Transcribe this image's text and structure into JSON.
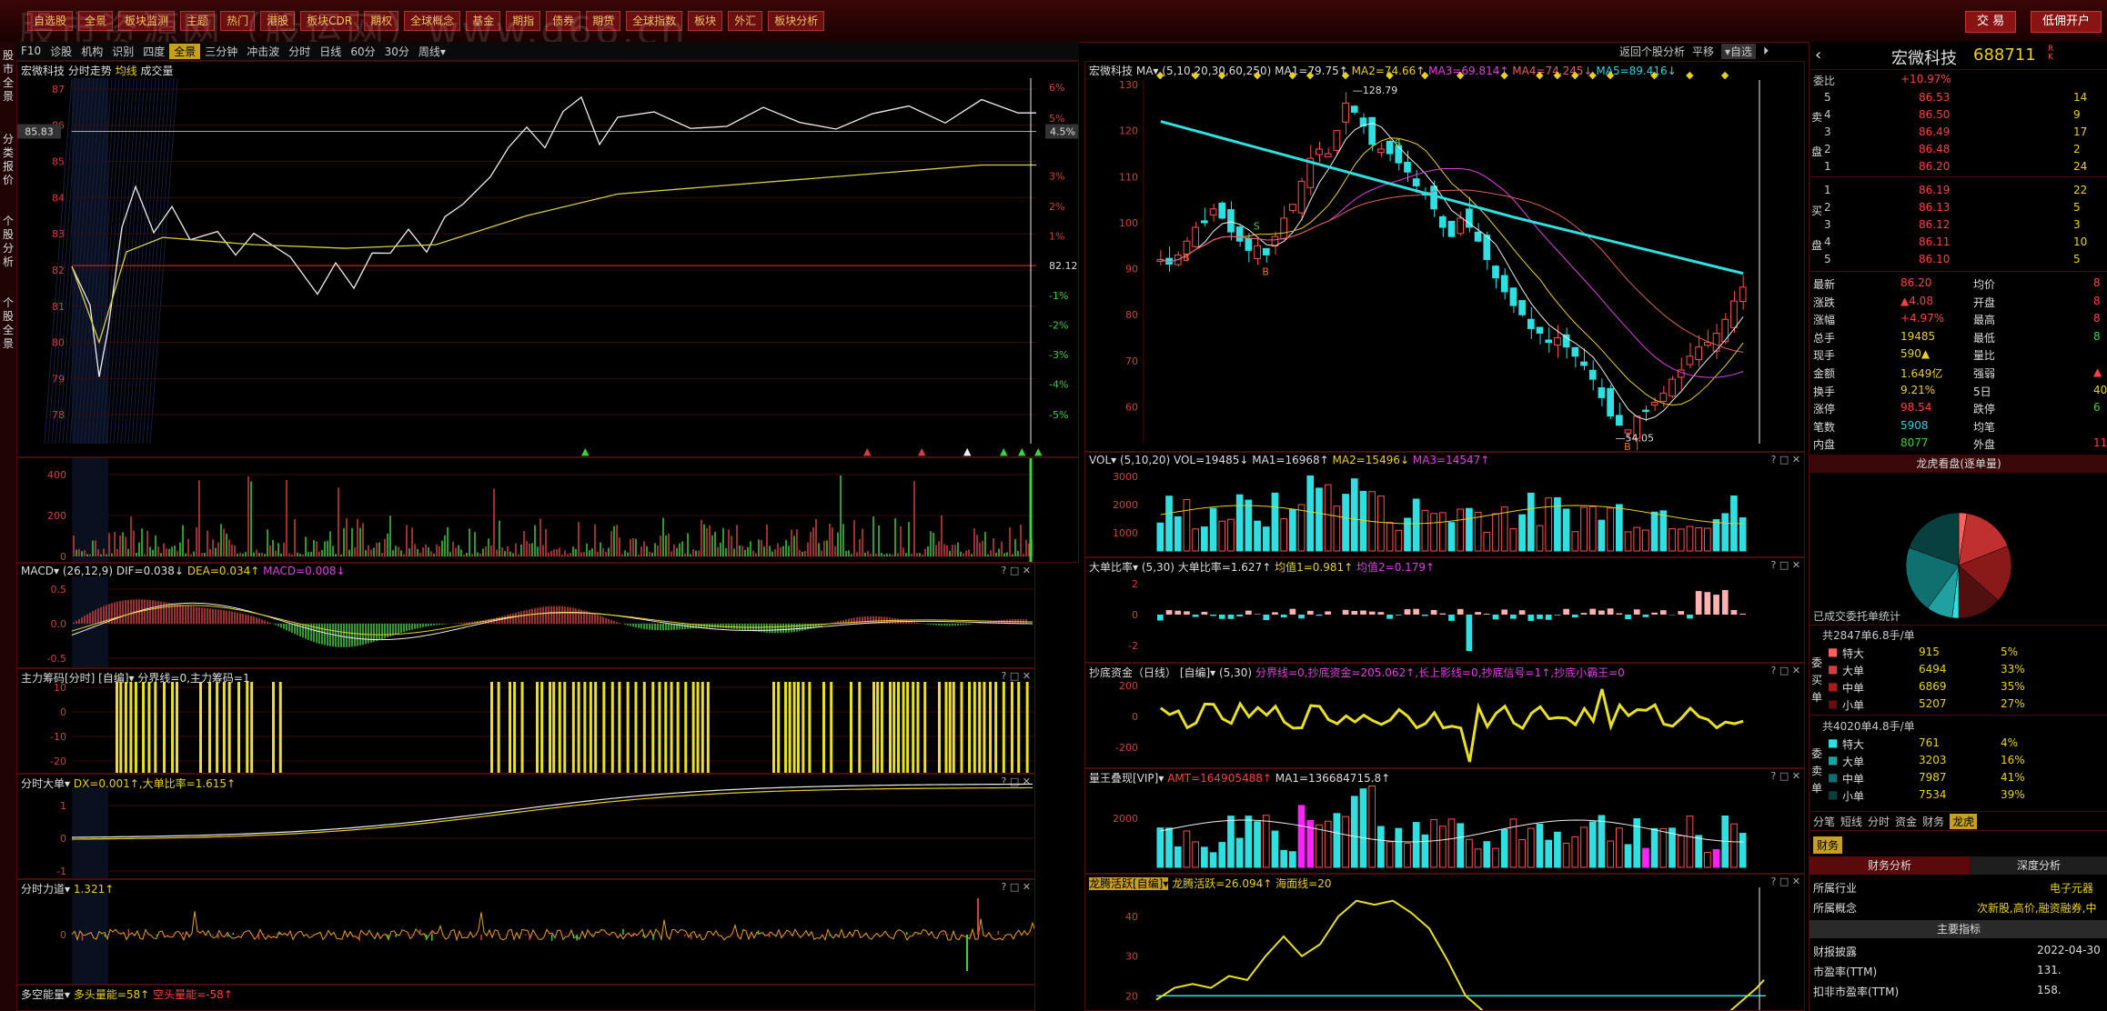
{
  "watermark": "股市资源网（股运网）www.g66.cn",
  "menu": [
    "自选股",
    "全景",
    "板块监测",
    "主题",
    "热门",
    "港股",
    "板块CDR",
    "期权",
    "全球概念",
    "基金",
    "期指",
    "债券",
    "期货",
    "全球指数",
    "板块",
    "外汇",
    "板块分析"
  ],
  "top_buttons": {
    "trade": "交 易",
    "open_account": "低佣开户"
  },
  "left_tabs": [
    "股市全景",
    "分类报价",
    "个股分析",
    "个股全景"
  ],
  "toolbar": [
    "F10",
    "诊股",
    "机构",
    "识别",
    "四度",
    "全景",
    "三分钟",
    "冲击波",
    "分时",
    "日线",
    "60分",
    "30分",
    "周线▾"
  ],
  "toolbar_right": [
    "返回个股分析",
    "平移",
    "▾自选"
  ],
  "left_main": {
    "title": "宏微科技",
    "sub": [
      "分时走势",
      "均线",
      "成交量"
    ],
    "price_ticks": [
      "87",
      "86",
      "85",
      "84",
      "83",
      "82",
      "81",
      "80",
      "79",
      "78"
    ],
    "pct_ticks": [
      "6%",
      "5%",
      "4.5%",
      "3%",
      "2%",
      "1%",
      "",
      "-1%",
      "-2%",
      "-3%",
      "-4%",
      "-5%"
    ],
    "price_box": "85.83",
    "ref_price": "82.12"
  },
  "left_ind": {
    "macd": {
      "title": "MACD▾",
      "params": "(26,12,9)",
      "dif": "DIF=0.038↓",
      "dea": "DEA=0.034↑",
      "macd": "MACD=0.008↓"
    },
    "zlcm": {
      "title": "主力筹码[分时] [自编]▾",
      "txt": "分界线=0,主力筹码=1"
    },
    "dd": {
      "title": "分时大单▾",
      "txt": "DX=0.001↑,大单比率=1.615↑"
    },
    "ld": {
      "title": "分时力道▾",
      "txt": "1.321↑"
    },
    "dk": {
      "title": "多空能量▾",
      "txt": "多头量能=58↑",
      "txt2": "空头量能=-58↑"
    }
  },
  "kline": {
    "title": "宏微科技",
    "ma_label": "MA▾",
    "ma_params": "(5,10,20,30,60,250)",
    "ma": [
      "MA1=79.75↑",
      "MA2=74.66↑",
      "MA3=69.814↑",
      "MA4=74.245↓",
      "MA5=89.416↓"
    ],
    "ticks": [
      "130",
      "120",
      "110",
      "100",
      "90",
      "80",
      "70",
      "60"
    ],
    "high_label": "128.79",
    "low_label": "54.05"
  },
  "right_ind": {
    "vol": {
      "title": "VOL▾",
      "params": "(5,10,20)",
      "txt": "VOL=19485↓",
      "ma1": "MA1=16968↑",
      "ma2": "MA2=15496↓",
      "ma3": "MA3=14547↑",
      "ticks": [
        "3000",
        "2000",
        "1000"
      ]
    },
    "ddb": {
      "title": "大单比率▾",
      "params": "(5,30)",
      "txt": "大单比率=1.627↑",
      "j1": "均值1=0.981↑",
      "j2": "均值2=0.179↑",
      "ticks": [
        "2",
        "0",
        "-2"
      ]
    },
    "cdzj": {
      "title": "抄底资金（日线） [自编]▾",
      "params": "(5,30)",
      "txt": "分界线=0,抄底资金=205.062↑,长上影线=0,抄底信号=1↑,抄底小霸王=0",
      "ticks": [
        "200",
        "0",
        "-200"
      ]
    },
    "lwfx": {
      "title": "量王叠现[VIP]▾",
      "amt": "AMT=164905488↑",
      "ma1": "MA1=136684715.8↑",
      "ticks": [
        "2000"
      ]
    },
    "lthy": {
      "title": "龙腾活跃[自编]▾",
      "txt": "龙腾活跃=26.094↑",
      "line": "海面线=20",
      "ticks": [
        "40",
        "30",
        "20"
      ]
    }
  },
  "quote": {
    "name": "宏微科技",
    "code": "688711",
    "rk": "R K",
    "wb_label": "委比",
    "wb": "+10.97%",
    "sell": [
      [
        "5",
        "86.53",
        "14"
      ],
      [
        "4",
        "86.50",
        "9"
      ],
      [
        "3",
        "86.49",
        "17"
      ],
      [
        "2",
        "86.48",
        "2"
      ],
      [
        "1",
        "86.20",
        "24"
      ]
    ],
    "buy": [
      [
        "1",
        "86.19",
        "22"
      ],
      [
        "2",
        "86.13",
        "5"
      ],
      [
        "3",
        "86.12",
        "3"
      ],
      [
        "4",
        "86.11",
        "10"
      ],
      [
        "5",
        "86.10",
        "5"
      ]
    ],
    "sell_side_label": [
      "卖",
      "盘"
    ],
    "buy_side_label": [
      "买",
      "盘"
    ],
    "stats": [
      [
        "最新",
        "86.20",
        "均价",
        "8"
      ],
      [
        "涨跌",
        "▲4.08",
        "开盘",
        "8"
      ],
      [
        "涨幅",
        "+4.97%",
        "最高",
        "8"
      ],
      [
        "总手",
        "19485",
        "最低",
        "8"
      ],
      [
        "现手",
        "590▲",
        "量比",
        ""
      ],
      [
        "金额",
        "1.649亿",
        "强弱",
        "▲"
      ],
      [
        "换手",
        "9.21%",
        "5日",
        "40."
      ],
      [
        "涨停",
        "98.54",
        "跌停",
        "6"
      ],
      [
        "笔数",
        "5908",
        "均笔",
        ""
      ],
      [
        "内盘",
        "8077",
        "外盘",
        "11"
      ]
    ],
    "lhk_title": "龙虎看盘(逐单量)",
    "stat_title": "已成交委托单统计",
    "g1_head": "共2847单6.8手/单",
    "g1": [
      [
        "特大",
        "915",
        "5%"
      ],
      [
        "大单",
        "6494",
        "33%"
      ],
      [
        "中单",
        "6869",
        "35%"
      ],
      [
        "小单",
        "5207",
        "27%"
      ]
    ],
    "g1_side": [
      "委",
      "买",
      "单"
    ],
    "g2_head": "共4020单4.8手/单",
    "g2": [
      [
        "特大",
        "761",
        "4%"
      ],
      [
        "大单",
        "3203",
        "16%"
      ],
      [
        "中单",
        "7987",
        "41%"
      ],
      [
        "小单",
        "7534",
        "39%"
      ]
    ],
    "g2_side": [
      "委",
      "卖",
      "单"
    ],
    "tabs": [
      "分笔",
      "短线",
      "分时",
      "资金",
      "财务",
      "龙虎"
    ],
    "cw_tab": "财务",
    "sub_tabs": [
      "财务分析",
      "深度分析"
    ],
    "industry_label": "所属行业",
    "industry": "电子元器",
    "concept_label": "所属概念",
    "concept": "次新股,高价,融资融券,中",
    "main_ind": "主要指标",
    "fin": [
      [
        "财报披露",
        "2022-04-30"
      ],
      [
        "市盈率(TTM)",
        "131."
      ],
      [
        "扣非市盈率(TTM)",
        "158."
      ]
    ]
  },
  "colors": {
    "up": "#ff4040",
    "down": "#30e0e0",
    "yellow": "#e8d020",
    "bg": "#000000",
    "grid": "#4a0c0c"
  }
}
